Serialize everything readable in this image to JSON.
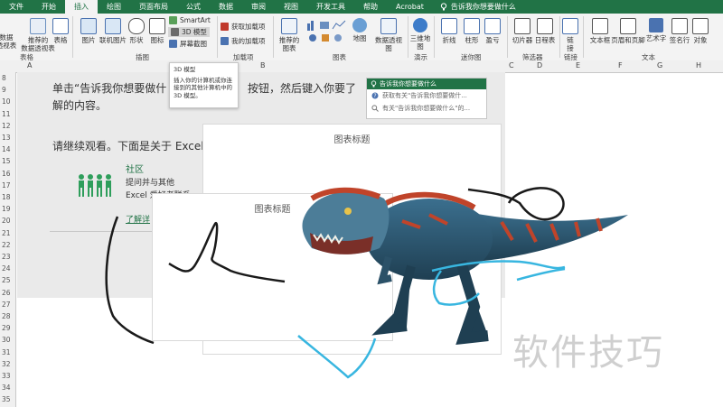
{
  "tabs": [
    "文件",
    "开始",
    "插入",
    "绘图",
    "页面布局",
    "公式",
    "数据",
    "审阅",
    "视图",
    "开发工具",
    "帮助",
    "Acrobat"
  ],
  "active_tab_index": 2,
  "tell_me": "告诉我你想要做什么",
  "ribbon": {
    "pivot": "数据\n透视表",
    "recommended_pivot": "推荐的\n数据透视表",
    "table": "表格",
    "group_tables": "表格",
    "pictures": "图片",
    "online_pictures": "联机图片",
    "shapes": "形状",
    "icons": "图标",
    "smartart": "SmartArt",
    "model3d": "3D 模型",
    "screenshot": "屏幕截图",
    "group_illustrations": "插图",
    "get_addins": "获取加载项",
    "my_addins": "我的加载项",
    "group_addins": "加载项",
    "recommended_charts": "推荐的\n图表",
    "maps": "地图",
    "pivot_chart": "数据透视图",
    "group_charts": "图表",
    "map3d": "三维地\n图",
    "group_tours": "演示",
    "line": "折线",
    "column": "柱形",
    "winloss": "盈亏",
    "group_sparklines": "迷你图",
    "slicer": "切片器",
    "timeline": "日程表",
    "group_filters": "筛选器",
    "link": "链\n接",
    "group_links": "链接",
    "textbox": "文本框",
    "header_footer": "页眉和页脚",
    "wordart": "艺术字",
    "signature": "签名行",
    "object": "对象",
    "group_text": "文本"
  },
  "columns": [
    "A",
    "B",
    "C",
    "D",
    "E",
    "F",
    "G",
    "H"
  ],
  "rows": [
    "8",
    "9",
    "10",
    "11",
    "12",
    "13",
    "14",
    "15",
    "16",
    "17",
    "18",
    "19",
    "20",
    "21",
    "22",
    "23",
    "24",
    "25",
    "26",
    "27",
    "28",
    "29",
    "30",
    "31",
    "32",
    "33",
    "34",
    "35"
  ],
  "tooltip": {
    "title": "3D 模型",
    "body": "插入你的计算机或你连接到的其他计算机中的 3D 模型。"
  },
  "dropdown": {
    "header": "告诉我你想要做什么",
    "item1": "获取有关\"告诉我你想要做什...",
    "item2": "有关\"告诉我你想要做什么\"的..."
  },
  "sheet": {
    "line1a": "单击“告诉我你想要做什",
    "line1b": "按钮，然后键入你要了",
    "line2": "解的内容。",
    "line3": "请继续观看。下面是关于 Excel",
    "community": "社区",
    "ask": "提问并与其他",
    "excel_fans": "Excel 爱好者联系",
    "learn_more": "了解详"
  },
  "chart_large_title": "图表标题",
  "chart_small_title": "图表标题",
  "watermark": "软件技巧",
  "colors": {
    "accent": "#217346",
    "ink_black": "#1a1a1a",
    "ink_cyan": "#38b6e0"
  }
}
